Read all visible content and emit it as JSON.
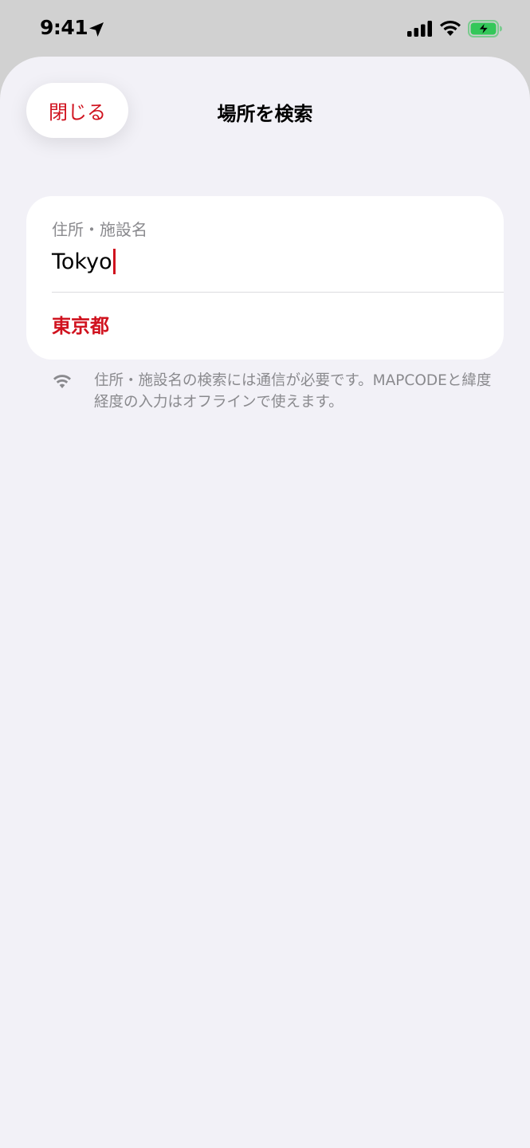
{
  "status_bar": {
    "time": "9:41"
  },
  "sheet": {
    "title": "場所を検索",
    "close_label": "閉じる"
  },
  "search": {
    "label": "住所・施設名",
    "value": "Tokyo"
  },
  "results": [
    {
      "label": "東京都"
    }
  ],
  "note": {
    "text": "住所・施設名の検索には通信が必要です。MAPCODEと緯度経度の入力はオフラインで使えます。",
    "icon": "wifi-icon"
  },
  "colors": {
    "accent": "#d0121e",
    "sheet_background": "#f2f1f7",
    "battery_fill": "#34c759"
  }
}
